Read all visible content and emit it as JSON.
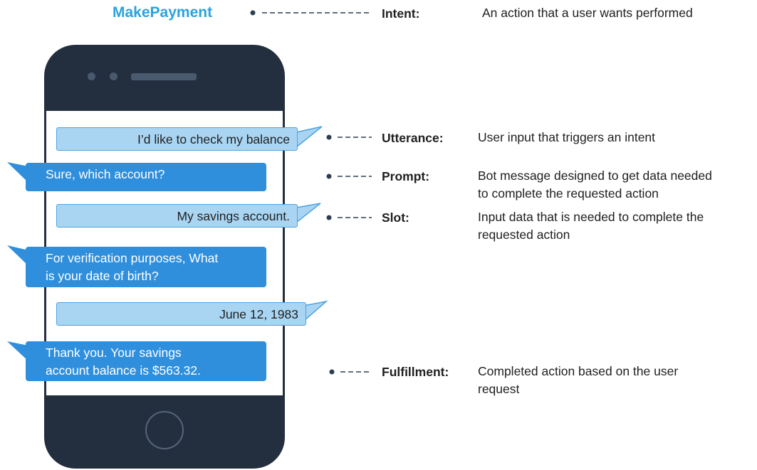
{
  "intent_name": "MakePayment",
  "conversation": [
    {
      "role": "user",
      "text": "I’d like to check my balance"
    },
    {
      "role": "bot",
      "lines": [
        "Sure, which account?"
      ]
    },
    {
      "role": "user",
      "text": "My savings account."
    },
    {
      "role": "bot",
      "lines": [
        "For verification purposes, What",
        "is your date of birth?"
      ]
    },
    {
      "role": "user",
      "text": "June 12, 1983"
    },
    {
      "role": "bot",
      "lines": [
        "Thank you. Your savings",
        "account balance is $563.32."
      ]
    }
  ],
  "concepts": [
    {
      "term": "Intent:",
      "definition": [
        "An action that a user wants performed"
      ]
    },
    {
      "term": "Utterance:",
      "definition": [
        "User input that triggers an intent"
      ]
    },
    {
      "term": "Prompt:",
      "definition": [
        "Bot message designed to get data needed",
        "to complete the requested action"
      ]
    },
    {
      "term": "Slot:",
      "definition": [
        "Input data that is needed to complete the",
        "requested action"
      ]
    },
    {
      "term": "Fulfillment:",
      "definition": [
        "Completed action based on the user",
        "request"
      ]
    }
  ],
  "colors": {
    "intent_name": "#29a3dd",
    "phone_body": "#232f3e",
    "user_bubble": "#a9d5f3",
    "bot_bubble": "#2f8fdc",
    "connector": "#2d3e50"
  }
}
